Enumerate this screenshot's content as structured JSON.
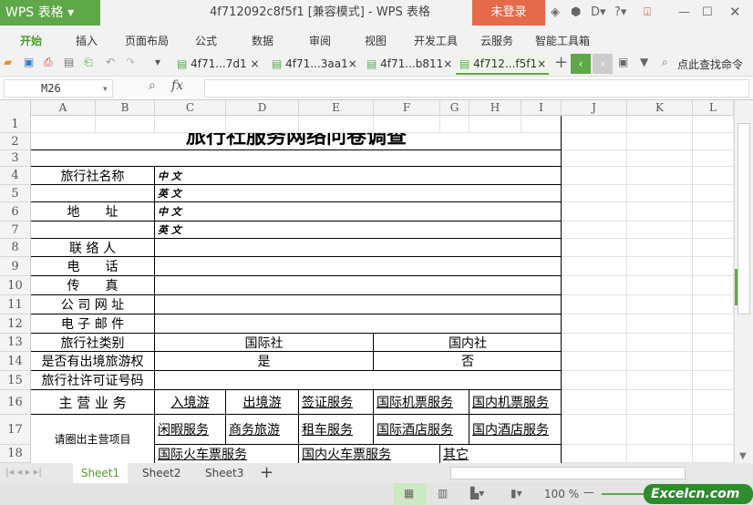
{
  "app": {
    "logo": "WPS 表格",
    "title": "4f712092c8f5f1 [兼容模式] - WPS 表格",
    "login": "未登录"
  },
  "menu": [
    "开始",
    "插入",
    "页面布局",
    "公式",
    "数据",
    "审阅",
    "视图",
    "开发工具",
    "云服务",
    "智能工具箱"
  ],
  "doc_tabs": [
    "4f71...7d1",
    "4f71...3aa1",
    "4f71...b811",
    "4f712...f5f1"
  ],
  "search_cmd": "点此查找命令",
  "formula": {
    "cell_ref": "M26",
    "fx": "fx",
    "value": ""
  },
  "columns": [
    "A",
    "B",
    "C",
    "D",
    "E",
    "F",
    "G",
    "H",
    "I",
    "J",
    "K",
    "L"
  ],
  "rows": [
    "1",
    "2",
    "3",
    "4",
    "5",
    "6",
    "7",
    "8",
    "9",
    "10",
    "11",
    "12",
    "13",
    "14",
    "15",
    "16",
    "17",
    "18"
  ],
  "sheet": {
    "title": "旅行社服务网络问卷调查",
    "agency_name": "旅行社名称",
    "cn": "中 文",
    "en": "英 文",
    "address": "地　　址",
    "contact": "联 络 人",
    "phone": "电　　话",
    "fax": "传　　真",
    "website": "公 司 网 址",
    "email": "电 子 邮 件",
    "agency_type": "旅行社类别",
    "intl": "国际社",
    "domestic": "国内社",
    "outbound_right": "是否有出境旅游权",
    "yes": "是",
    "no": "否",
    "license": "旅行社许可证号码",
    "main_business": "主 营 业 务",
    "circle_hint": "请圈出主营项目",
    "services": [
      "入境游",
      "出境游",
      "签证服务",
      "国际机票服务",
      "国内机票服务",
      "闲暇服务",
      "商务旅游",
      "租车服务",
      "国际酒店服务",
      "国内酒店服务",
      "国际火车票服务",
      "国内火车票服务",
      "其它"
    ]
  },
  "sheets": [
    "Sheet1",
    "Sheet2",
    "Sheet3"
  ],
  "zoom": "100 %",
  "watermark": "Excelcn.com"
}
